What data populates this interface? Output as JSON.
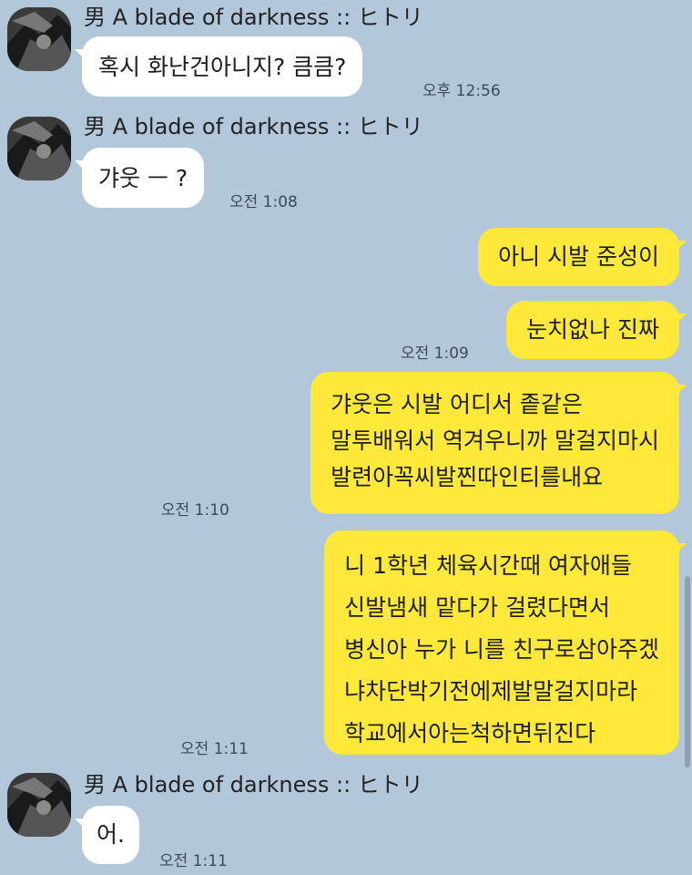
{
  "colors": {
    "background": "#b2c7d9",
    "incoming_bubble": "#ffffff",
    "outgoing_bubble": "#fee93b"
  },
  "sender_name": "男 A blade of darkness :: ヒトリ",
  "messages": [
    {
      "direction": "incoming",
      "sender": "男 A blade of darkness :: ヒトリ",
      "text": "혹시 화난건아니지? 큼큼?",
      "time": "오후 12:56"
    },
    {
      "direction": "incoming",
      "sender": "男 A blade of darkness :: ヒトリ",
      "text": "갸웃 ㅡ ?",
      "time": "오전 1:08"
    },
    {
      "direction": "outgoing",
      "text": "아니 시발 준성이",
      "time": ""
    },
    {
      "direction": "outgoing",
      "text": "눈치없나 진짜",
      "time": "오전 1:09"
    },
    {
      "direction": "outgoing",
      "text": "갸웃은 시발 어디서 좉같은\n말투배워서 역겨우니까 말걸지마시\n발련아꼭씨발찐따인티를내요",
      "time": "오전 1:10"
    },
    {
      "direction": "outgoing",
      "text": "니 1학년 체육시간때 여자애들\n신발냄새 맡다가 걸렸다면서\n병신아 누가 니를 친구로삼아주겠\n냐차단박기전에제발말걸지마라\n학교에서아는척하면뒤진다",
      "time": "오전 1:11"
    },
    {
      "direction": "incoming",
      "sender": "男 A blade of darkness :: ヒトリ",
      "text": "어.",
      "time": "오전 1:11"
    }
  ],
  "icons": {
    "avatar": "profile-avatar-icon"
  }
}
